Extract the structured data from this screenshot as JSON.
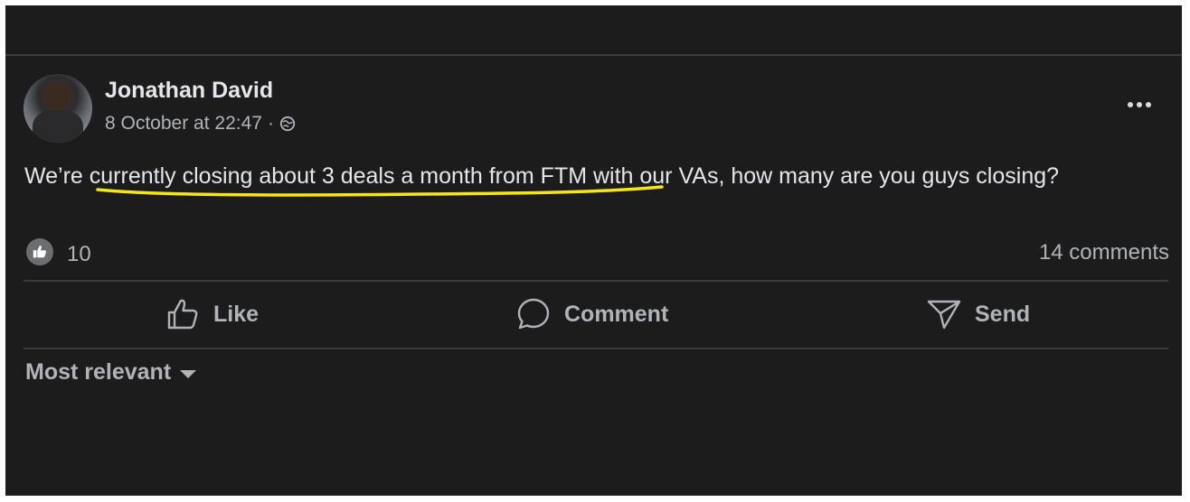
{
  "post": {
    "author": "Jonathan David",
    "timestamp": "8 October at 22:47",
    "separator": "·",
    "audience_icon": "globe-icon",
    "text_before": "We’re ",
    "text_highlight": "currently closing about 3 deals a month from FTM",
    "text_after": " with our VAs, how many are you guys closing?",
    "highlight_color": "#f5e61a"
  },
  "reactions": {
    "icon": "thumbs-up-icon",
    "count": "10",
    "comments": "14 comments"
  },
  "actions": {
    "like": "Like",
    "comment": "Comment",
    "send": "Send"
  },
  "comments_sort": {
    "label": "Most relevant",
    "icon": "caret-down-icon"
  },
  "colors": {
    "background": "#1c1c1d",
    "text_primary": "#e4e6eb",
    "text_secondary": "#b0b3b8"
  }
}
